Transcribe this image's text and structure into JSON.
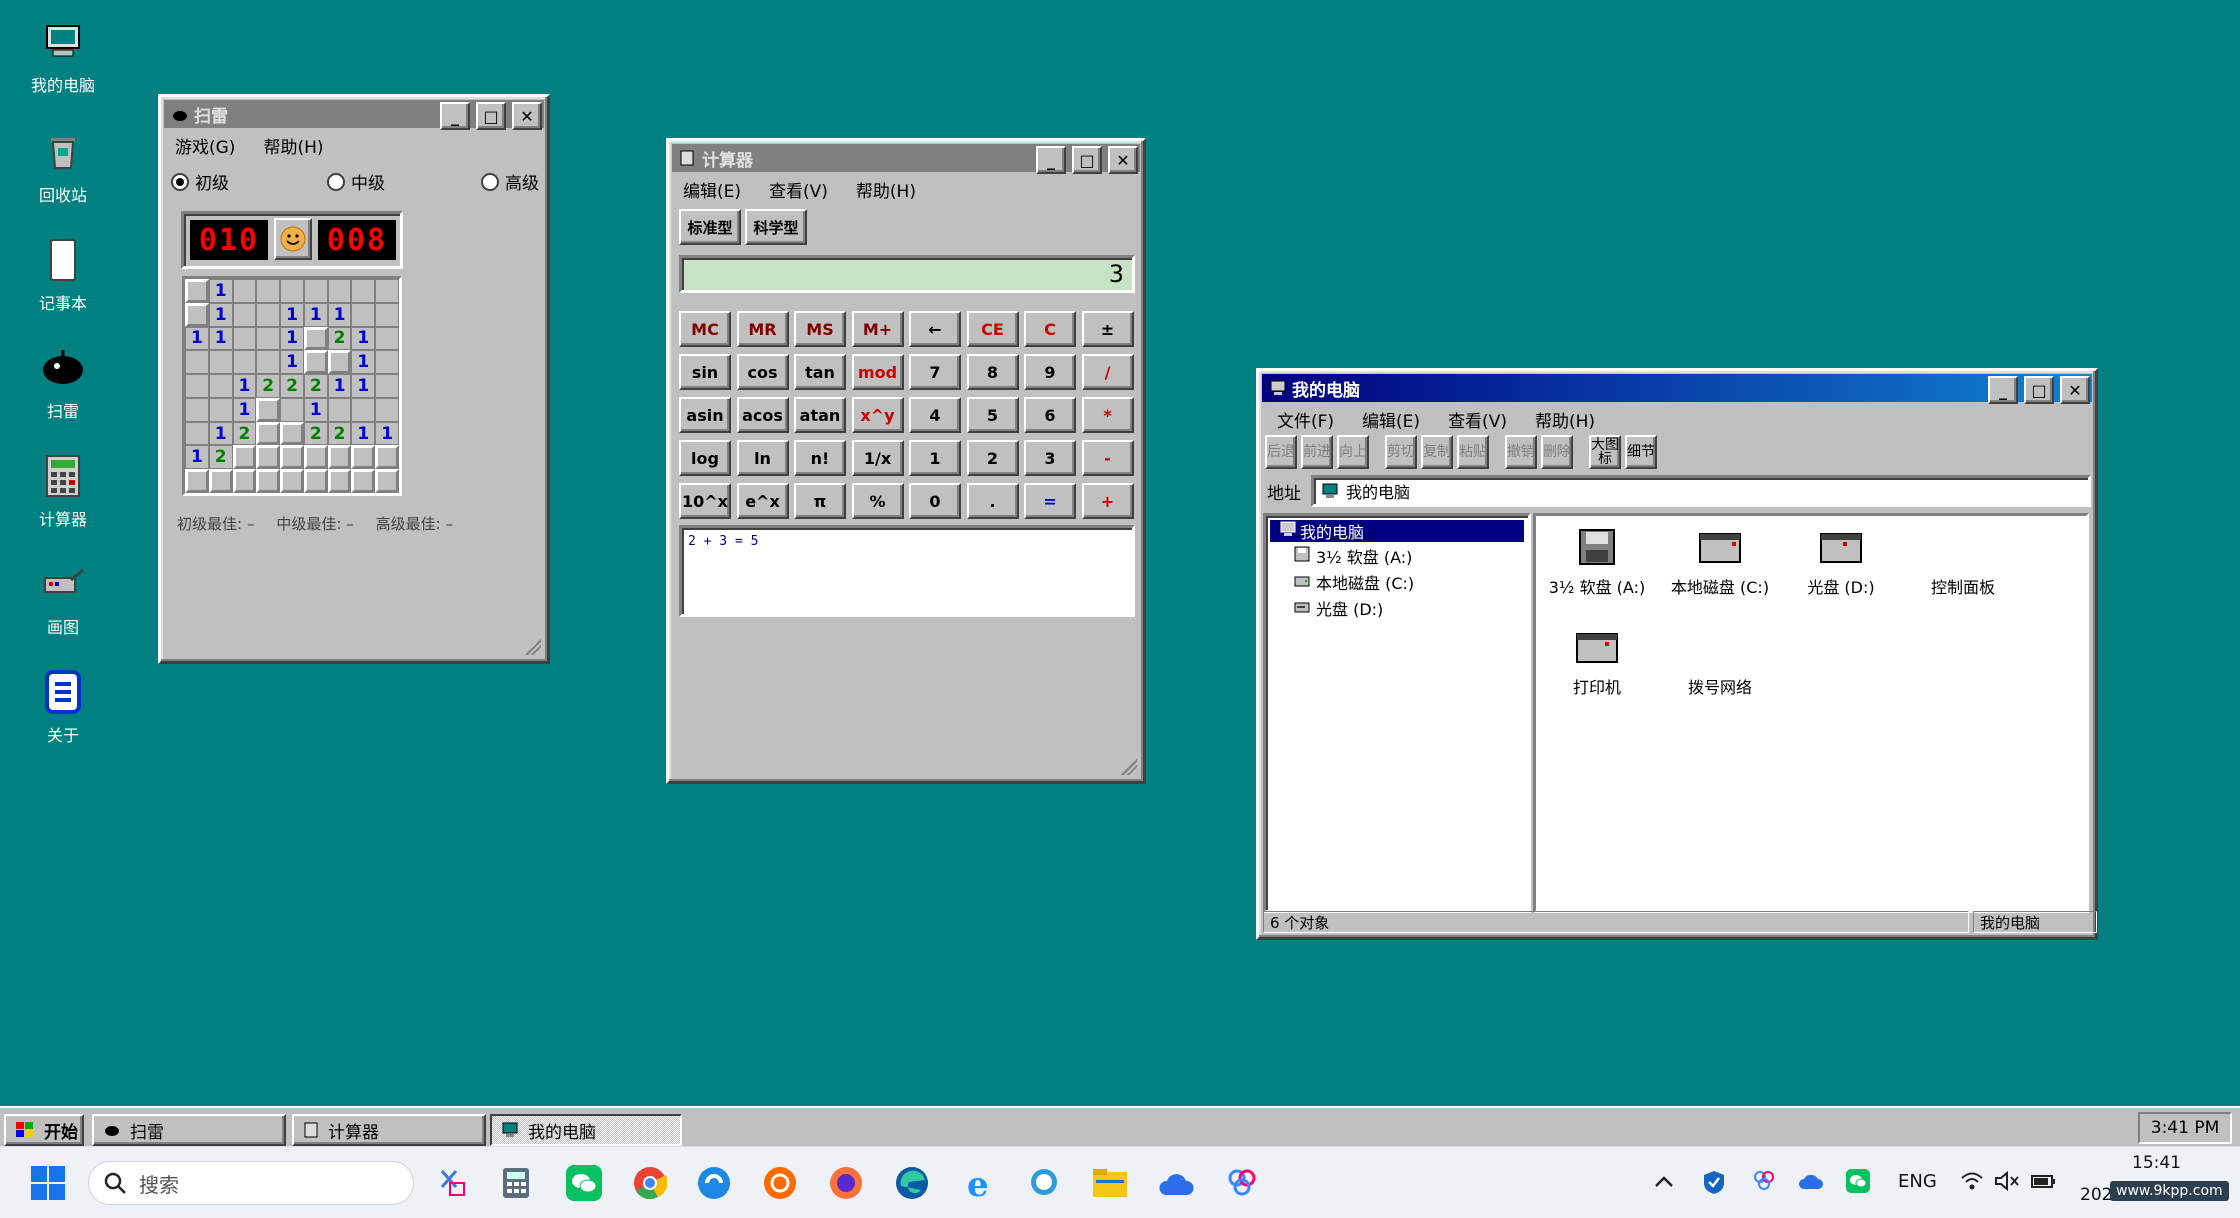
{
  "desktop": {
    "icons": [
      {
        "label": "我的电脑",
        "icon": "computer-icon"
      },
      {
        "label": "回收站",
        "icon": "recycle-bin-icon"
      },
      {
        "label": "记事本",
        "icon": "notepad-icon"
      },
      {
        "label": "扫雷",
        "icon": "mine-icon"
      },
      {
        "label": "计算器",
        "icon": "calculator-icon"
      },
      {
        "label": "画图",
        "icon": "paint-icon"
      },
      {
        "label": "关于",
        "icon": "about-icon"
      }
    ]
  },
  "minesweeper": {
    "title": "扫雷",
    "menu": [
      "游戏(G)",
      "帮助(H)"
    ],
    "levels": [
      {
        "label": "初级",
        "checked": true
      },
      {
        "label": "中级",
        "checked": false
      },
      {
        "label": "高级",
        "checked": false
      }
    ],
    "mine_counter": "010",
    "timer": "008",
    "face": "smiley-icon",
    "grid": [
      [
        "C",
        "1",
        "",
        "",
        "",
        "",
        "",
        "",
        ""
      ],
      [
        "C",
        "1",
        "",
        "",
        "1",
        "1",
        "1",
        "",
        ""
      ],
      [
        "1",
        "1",
        "",
        "",
        "1",
        "C",
        "2",
        "1",
        ""
      ],
      [
        "",
        "",
        "",
        "",
        "1",
        "C",
        "C",
        "1",
        ""
      ],
      [
        "",
        "",
        "1",
        "2",
        "2",
        "2",
        "1",
        "1",
        ""
      ],
      [
        "",
        "",
        "1",
        "C",
        "",
        "1",
        "",
        "",
        ""
      ],
      [
        "",
        "1",
        "2",
        "C",
        "C",
        "2",
        "2",
        "1",
        "1"
      ],
      [
        "1",
        "2",
        "C",
        "C",
        "C",
        "C",
        "C",
        "C",
        "C"
      ],
      [
        "C",
        "C",
        "C",
        "C",
        "C",
        "C",
        "C",
        "C",
        "C"
      ]
    ],
    "best_scores": [
      "初级最佳: –",
      "中级最佳: –",
      "高级最佳: –"
    ]
  },
  "calculator": {
    "title": "计算器",
    "menu": [
      "编辑(E)",
      "查看(V)",
      "帮助(H)"
    ],
    "modes": [
      "标准型",
      "科学型"
    ],
    "display": "3",
    "history": "2 + 3 = 5",
    "keys": [
      [
        "MC",
        "MR",
        "MS",
        "M+",
        "←",
        "CE",
        "C",
        "±"
      ],
      [
        "sin",
        "cos",
        "tan",
        "mod",
        "7",
        "8",
        "9",
        "/"
      ],
      [
        "asin",
        "acos",
        "atan",
        "x^y",
        "4",
        "5",
        "6",
        "*"
      ],
      [
        "log",
        "ln",
        "n!",
        "1/x",
        "1",
        "2",
        "3",
        "-"
      ],
      [
        "10^x",
        "e^x",
        "π",
        "%",
        "0",
        ".",
        "=",
        "+"
      ]
    ]
  },
  "explorer": {
    "title": "我的电脑",
    "menu": [
      "文件(F)",
      "编辑(E)",
      "查看(V)",
      "帮助(H)"
    ],
    "toolbar": [
      "后退",
      "前进",
      "向上",
      "剪切",
      "复制",
      "粘贴",
      "撤销",
      "删除",
      "大图标",
      "细节"
    ],
    "address_label": "地址",
    "address_value": "我的电脑",
    "tree": [
      "我的电脑",
      "3½ 软盘 (A:)",
      "本地磁盘 (C:)",
      "光盘 (D:)"
    ],
    "items": [
      {
        "label": "3½ 软盘 (A:)",
        "icon": "floppy-icon"
      },
      {
        "label": "本地磁盘 (C:)",
        "icon": "hard-disk-icon"
      },
      {
        "label": "光盘 (D:)",
        "icon": "cd-drive-icon"
      },
      {
        "label": "控制面板",
        "icon": "control-panel-icon"
      },
      {
        "label": "打印机",
        "icon": "printer-icon"
      },
      {
        "label": "拨号网络",
        "icon": "dialup-icon"
      }
    ],
    "status_left": "6 个对象",
    "status_right": "我的电脑"
  },
  "taskbar98": {
    "start": "开始",
    "tasks": [
      "扫雷",
      "计算器",
      "我的电脑"
    ],
    "clock": "3:41 PM"
  },
  "win11": {
    "search_placeholder": "搜索",
    "lang": "ENG",
    "time": "15:41",
    "date_partial": "202",
    "watermark": "www.9kpp.com"
  },
  "colors": {
    "desktop": "#008080",
    "title_active": "#000080",
    "title_inactive": "#808080",
    "calc_display": "#c6e3c6"
  }
}
